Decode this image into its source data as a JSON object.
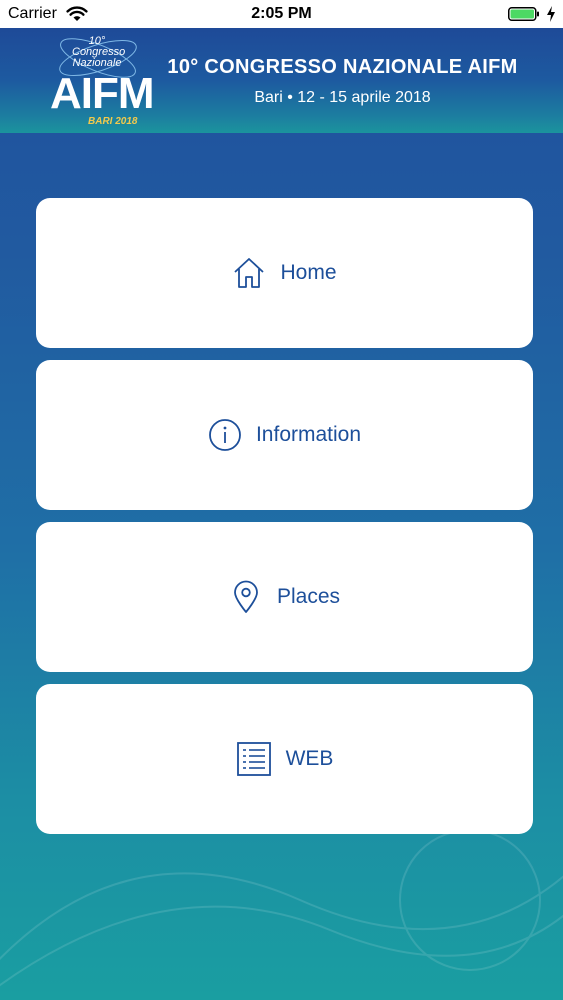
{
  "status_bar": {
    "carrier": "Carrier",
    "time": "2:05 PM",
    "icons": [
      "wifi-icon",
      "battery-icon",
      "charging-bolt-icon"
    ]
  },
  "header": {
    "logo": {
      "top_text": "10° Congresso Nazionale",
      "main_text": "AIFM",
      "bottom_text": "BARI 2018"
    },
    "title": "10° CONGRESSO NAZIONALE AIFM",
    "subtitle": "Bari • 12 - 15 aprile 2018"
  },
  "menu": [
    {
      "label": "Home",
      "icon": "home-icon"
    },
    {
      "label": "Information",
      "icon": "info-icon"
    },
    {
      "label": "Places",
      "icon": "location-pin-icon"
    },
    {
      "label": "WEB",
      "icon": "list-icon"
    }
  ],
  "colors": {
    "accent": "#1d4f9a",
    "background_top": "#1f4f9d",
    "background_bottom": "#1a9ea1",
    "logo_gold": "#f2c94c"
  }
}
